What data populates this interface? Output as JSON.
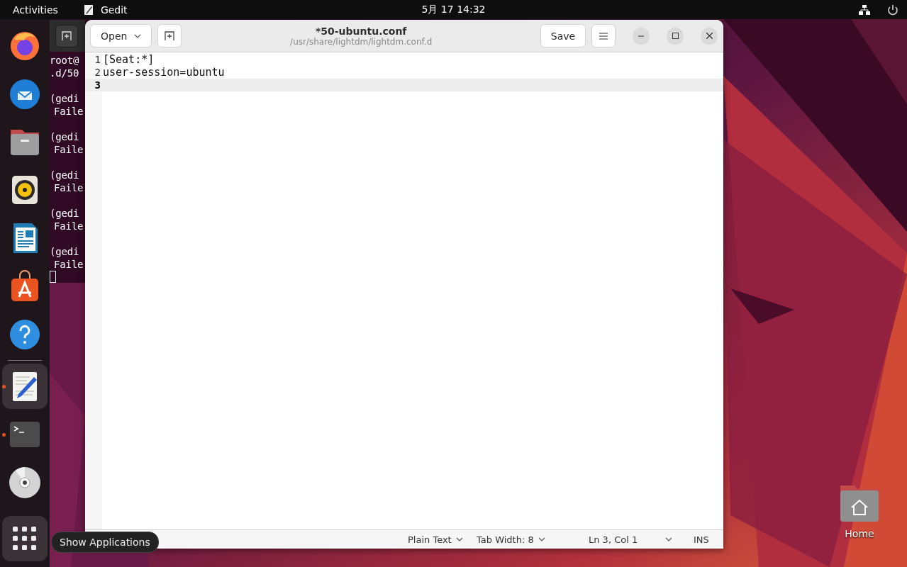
{
  "top_bar": {
    "activities": "Activities",
    "app_name": "Gedit",
    "clock": "5月 17  14:32"
  },
  "dock": {
    "items": [
      {
        "kind": "firefox",
        "active": false,
        "running": false
      },
      {
        "kind": "thunderbird",
        "active": false,
        "running": false
      },
      {
        "kind": "files",
        "active": false,
        "running": false
      },
      {
        "kind": "rhythmbox",
        "active": false,
        "running": false
      },
      {
        "kind": "writer",
        "active": false,
        "running": false
      },
      {
        "kind": "appcenter",
        "active": false,
        "running": false
      },
      {
        "kind": "help",
        "active": false,
        "running": false
      },
      {
        "kind": "separator"
      },
      {
        "kind": "gedit",
        "active": true,
        "running": true
      },
      {
        "kind": "terminal",
        "active": false,
        "running": true
      },
      {
        "kind": "disc",
        "active": false,
        "running": false
      }
    ],
    "show_apps_tooltip": "Show Applications"
  },
  "terminal": {
    "blocks": [
      [
        "root@",
        ".d/50"
      ],
      [
        "(gedi",
        "Faile"
      ],
      [
        "(gedi",
        "Faile"
      ],
      [
        "(gedi",
        "Faile"
      ],
      [
        "(gedi",
        "Faile"
      ],
      [
        "(gedi",
        "Faile"
      ]
    ]
  },
  "gedit": {
    "open_button": "Open",
    "title": "*50-ubuntu.conf",
    "subtitle": "/usr/share/lightdm/lightdm.conf.d",
    "save_button": "Save",
    "lines": [
      {
        "number": "1",
        "text": "[Seat:*]",
        "current": false
      },
      {
        "number": "2",
        "text": "user-session=ubuntu",
        "current": false
      },
      {
        "number": "3",
        "current": true
      }
    ],
    "status_bar": {
      "language": "Plain Text",
      "tab_width": "Tab Width: 8",
      "position": "Ln 3, Col 1",
      "mode": "INS"
    }
  },
  "desktop": {
    "home_label": "Home"
  }
}
